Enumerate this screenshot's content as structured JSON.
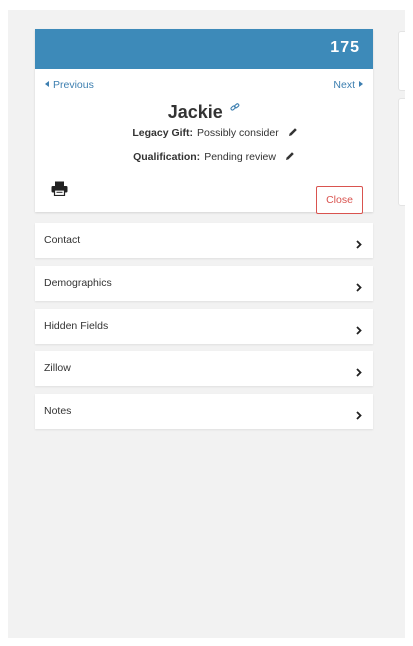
{
  "record": {
    "number": "175",
    "previous_label": "Previous",
    "next_label": "Next",
    "name": "Jackie"
  },
  "fields": {
    "legacy_gift": {
      "label": "Legacy Gift:",
      "value": "Possibly consider"
    },
    "qualification": {
      "label": "Qualification:",
      "value": "Pending review"
    }
  },
  "actions": {
    "close_label": "Close"
  },
  "sections": [
    {
      "label": "Contact"
    },
    {
      "label": "Demographics"
    },
    {
      "label": "Hidden Fields"
    },
    {
      "label": "Zillow"
    },
    {
      "label": "Notes"
    }
  ],
  "icons": {
    "link": "link-icon",
    "edit": "pencil-icon",
    "print": "printer-icon",
    "expand": "chevron-right-icon"
  },
  "colors": {
    "header": "#3d8ab9",
    "link": "#3d7fb0",
    "close": "#d9534f",
    "background": "#f2f2f2"
  }
}
